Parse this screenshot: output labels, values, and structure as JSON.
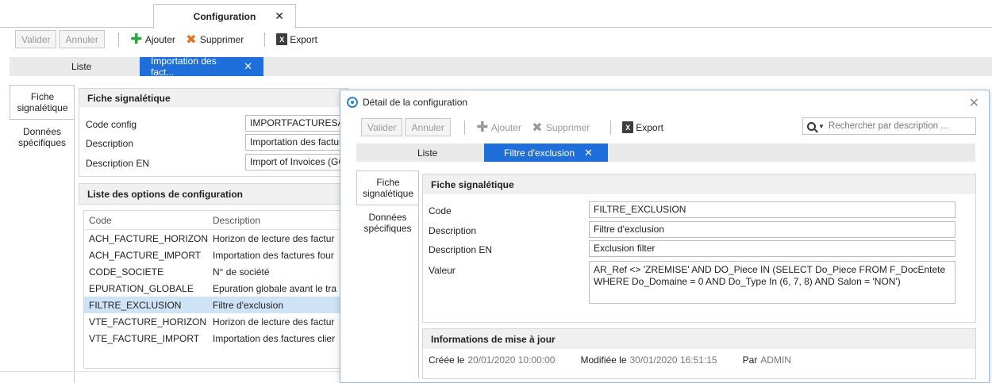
{
  "top_tab": {
    "label": "Configuration",
    "close": "✕"
  },
  "toolbar": {
    "validate": "Valider",
    "cancel": "Annuler",
    "add": "Ajouter",
    "delete": "Supprimer",
    "export": "Export"
  },
  "subtabs": {
    "list": "Liste",
    "active": "Importation des fact...",
    "close": "✕"
  },
  "vtabs": {
    "fiche": "Fiche signalétique",
    "donnees": "Données spécifiques"
  },
  "fiche": {
    "header": "Fiche signalétique",
    "code_label": "Code config",
    "code_value": "IMPORTFACTURESAGE",
    "desc_label": "Description",
    "desc_value": "Importation des factur",
    "descen_label": "Description EN",
    "descen_value": "Import of Invoices (GC"
  },
  "options": {
    "header": "Liste des options de configuration",
    "col_code": "Code",
    "col_desc": "Description",
    "rows": [
      {
        "code": "ACH_FACTURE_HORIZON",
        "desc": "Horizon de lecture des factur"
      },
      {
        "code": "ACH_FACTURE_IMPORT",
        "desc": "Importation des factures four"
      },
      {
        "code": "CODE_SOCIETE",
        "desc": "N° de société"
      },
      {
        "code": "EPURATION_GLOBALE",
        "desc": "Epuration globale avant le tra"
      },
      {
        "code": "FILTRE_EXCLUSION",
        "desc": "Filtre d'exclusion"
      },
      {
        "code": "VTE_FACTURE_HORIZON",
        "desc": "Horizon de lecture des factur"
      },
      {
        "code": "VTE_FACTURE_IMPORT",
        "desc": "Importation des factures clier"
      }
    ]
  },
  "modal": {
    "title": "Détail de la configuration",
    "close": "✕",
    "toolbar": {
      "validate": "Valider",
      "cancel": "Annuler",
      "add": "Ajouter",
      "delete": "Supprimer",
      "export": "Export"
    },
    "search_placeholder": "Rechercher par description ...",
    "subtabs": {
      "list": "Liste",
      "active": "Filtre d'exclusion",
      "close": "✕"
    },
    "vtabs": {
      "fiche": "Fiche signalétique",
      "donnees": "Données spécifiques"
    },
    "fiche": {
      "header": "Fiche signalétique",
      "code_label": "Code",
      "code_value": "FILTRE_EXCLUSION",
      "desc_label": "Description",
      "desc_value": "Filtre d'exclusion",
      "descen_label": "Description EN",
      "descen_value": "Exclusion filter",
      "valeur_label": "Valeur",
      "valeur_value": "AR_Ref <> 'ZREMISE' AND DO_Piece IN (SELECT Do_Piece FROM F_DocEntete WHERE Do_Domaine = 0 AND Do_Type In (6, 7, 8) AND Salon = 'NON')"
    },
    "info": {
      "header": "Informations de mise à jour",
      "created_label": "Créée le",
      "created_value": "20/01/2020 10:00:00",
      "modified_label": "Modifiée le",
      "modified_value": "30/01/2020 16:51:15",
      "by_label": "Par",
      "by_value": "ADMIN"
    }
  },
  "colors": {
    "accent": "#1e6fd9",
    "selected_row": "#cfe3f6",
    "add_icon": "#2da343",
    "delete_icon": "#e8711b"
  }
}
